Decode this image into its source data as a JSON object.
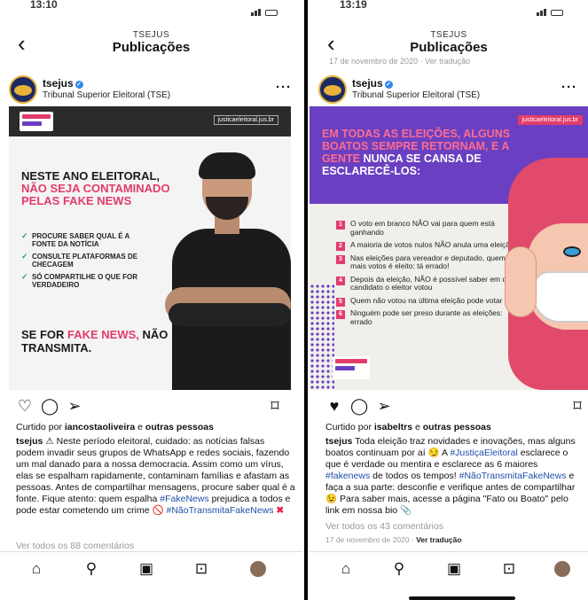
{
  "left": {
    "status_time": "13:10",
    "nav_sub": "TSEJUS",
    "nav_title": "Publicações",
    "username": "tsejus",
    "fullname": "Tribunal Superior Eleitoral (TSE)",
    "image": {
      "url": "justicaeleitoral.jus.br",
      "headline_a": "NESTE ANO ELEITORAL, ",
      "headline_b": "NÃO SEJA CONTAMINADO PELAS",
      "headline_c": " FAKE NEWS",
      "tips": [
        "PROCURE SABER QUAL É A FONTE DA NOTÍCIA",
        "CONSULTE PLATAFORMAS DE CHECAGEM",
        "SÓ COMPARTILHE O QUE FOR VERDADEIRO"
      ],
      "slogan_a": "SE FOR ",
      "slogan_b": "FAKE NEWS,",
      "slogan_c": " NÃO TRANSMITA."
    },
    "likes_prefix": "Curtido por ",
    "likes_user": "iancostaoliveira",
    "likes_mid": " e ",
    "likes_others": "outras pessoas",
    "caption_user": "tsejus",
    "caption_1": " ⚠ Neste período eleitoral, cuidado: as notícias falsas podem invadir seus grupos de WhatsApp e redes sociais, fazendo um mal danado para a nossa democracia. Assim como um vírus, elas se espalham rapidamente, contaminam famílias e afastam as pessoas. Antes de compartilhar mensagens, procure saber qual é a fonte. Fique atento: quem espalha ",
    "caption_tag1": "#FakeNews",
    "caption_2": " prejudica a todos e pode estar cometendo um crime ",
    "caption_no": "🚫",
    "caption_tag2": "#NãoTransmitaFakeNews",
    "caption_x": "✖",
    "comments": "Ver todos os 88 comentários"
  },
  "right": {
    "status_time": "13:19",
    "nav_sub": "TSEJUS",
    "nav_title": "Publicações",
    "top_date": "17 de novembro de 2020 · Ver tradução",
    "username": "tsejus",
    "fullname": "Tribunal Superior Eleitoral (TSE)",
    "image": {
      "url": "justicaeleitoral.jus.br",
      "headline_a": "EM TODAS AS ELEIÇÕES, ALGUNS BOATOS SEMPRE RETORNAM, E A GENTE ",
      "headline_b": "NUNCA SE CANSA DE ESCLARECÊ-LOS:",
      "items": [
        "O voto em branco NÃO vai para quem está ganhando",
        "A maioria de votos nulos NÃO anula uma eleição",
        "Nas eleições para vereador e deputado, quem tem mais votos é eleito: tá errado!",
        "Depois da eleição, NÃO é possível saber em qual candidato o eleitor votou",
        "Quem não votou na última eleição pode votar SIM",
        "Ninguém pode ser preso durante as eleições: errado"
      ],
      "numbers": [
        "1",
        "2",
        "3",
        "4",
        "5",
        "6"
      ]
    },
    "likes_prefix": "Curtido por ",
    "likes_user": "isabeltrs",
    "likes_mid": " e ",
    "likes_others": "outras pessoas",
    "caption_user": "tsejus",
    "caption_1": " Toda eleição traz novidades e inovações, mas alguns boatos continuam por aí 😏 A ",
    "caption_tag1": "#JustiçaEleitoral",
    "caption_2": " esclarece o que é verdade ou mentira e esclarece as 6 maiores ",
    "caption_tag2": "#fakenews",
    "caption_3": " de todos os tempos! ",
    "caption_tag3": "#NãoTransmitaFakeNews",
    "caption_4": " e faça a sua parte: desconfie e verifique antes de compartilhar 😉 Para saber mais, acesse a página \"Fato ou Boato\" pelo link em nossa bio 📎",
    "comments": "Ver todos os 43 comentários",
    "post_date": "17 de novembro de 2020 · ",
    "translate": "Ver tradução"
  },
  "colors": {
    "accent_pink": "#e23c6b",
    "purple": "#6a3fc1",
    "link": "#1f4fa8",
    "like_red": "#e8294a"
  },
  "icons": [
    "back-icon",
    "verified-icon",
    "more-icon",
    "heart-icon",
    "comment-icon",
    "share-icon",
    "bookmark-icon",
    "home-icon",
    "search-icon",
    "reels-icon",
    "shop-icon",
    "profile-icon"
  ]
}
